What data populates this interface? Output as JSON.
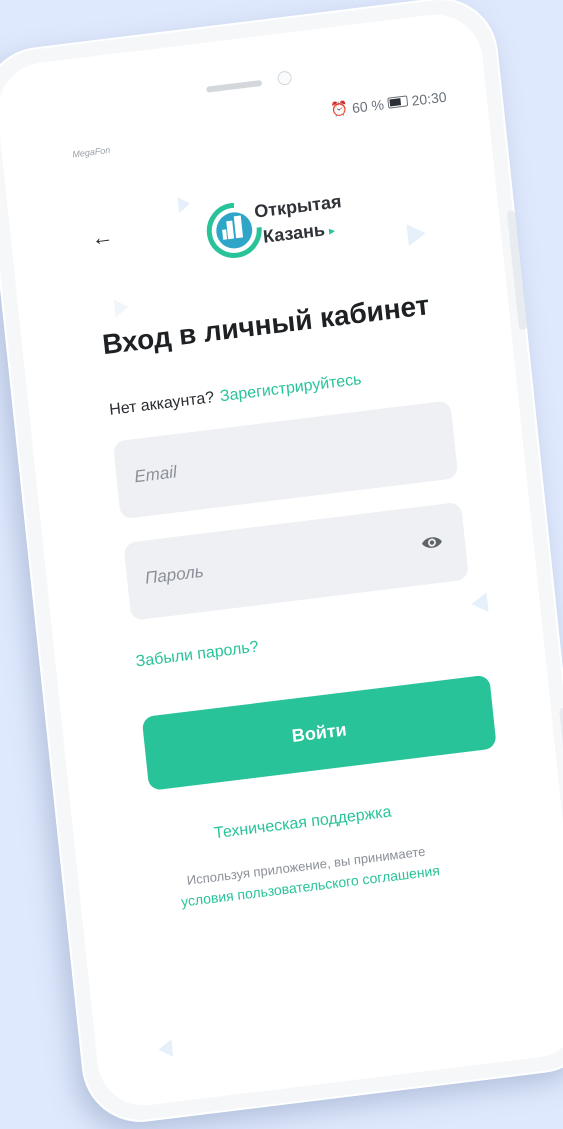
{
  "status_bar": {
    "carrier": "MegaFon",
    "battery_text": "60 %",
    "time": "20:30"
  },
  "logo": {
    "line1": "Открытая",
    "line2": "Казань"
  },
  "login": {
    "title": "Вход в личный кабинет",
    "no_account": "Нет аккаунта?",
    "register_link": "Зарегистрируйтесь",
    "email_placeholder": "Email",
    "password_placeholder": "Пароль",
    "forgot_link": "Забыли пароль?",
    "submit_label": "Войти",
    "support_link": "Техническая поддержка",
    "terms_text": "Используя приложение, вы принимаете",
    "terms_link": "условия пользовательского соглашения"
  },
  "colors": {
    "accent": "#29c39a",
    "background": "#dfe9fd",
    "field": "#eef0f3"
  },
  "icons": [
    "back-arrow-icon",
    "alarm-icon",
    "battery-icon",
    "eye-icon"
  ]
}
